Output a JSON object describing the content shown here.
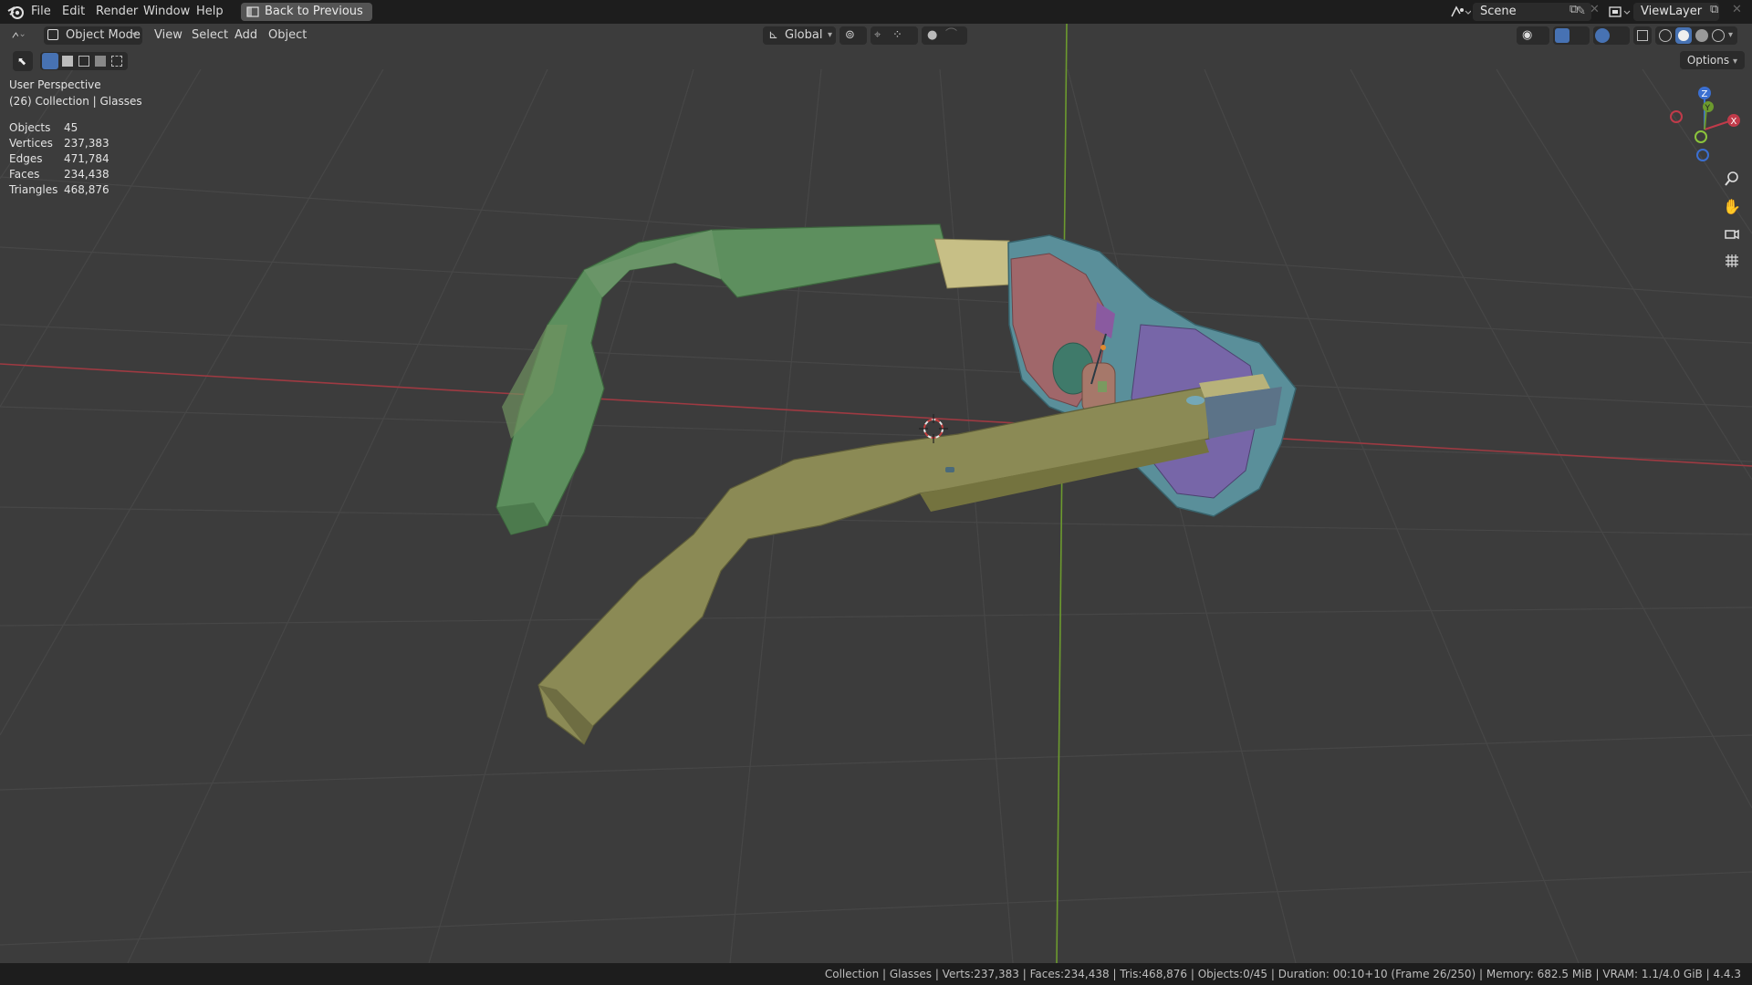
{
  "menu": {
    "items": [
      "File",
      "Edit",
      "Render",
      "Window",
      "Help"
    ],
    "back_button": "Back to Previous"
  },
  "scene": {
    "label": "Scene"
  },
  "view_layer": {
    "label": "ViewLayer"
  },
  "viewport_header": {
    "mode": "Object Mode",
    "menus": [
      "View",
      "Select",
      "Add",
      "Object"
    ],
    "orientation": "Global",
    "options": "Options"
  },
  "overlay": {
    "perspective": "User Perspective",
    "collection": "(26) Collection | Glasses"
  },
  "stats": [
    {
      "label": "Objects",
      "value": "45"
    },
    {
      "label": "Vertices",
      "value": "237,383"
    },
    {
      "label": "Edges",
      "value": "471,784"
    },
    {
      "label": "Faces",
      "value": "234,438"
    },
    {
      "label": "Triangles",
      "value": "468,876"
    }
  ],
  "gizmo": {
    "z": "Z",
    "y": "Y",
    "x": "X"
  },
  "status_bar": {
    "text": "Collection | Glasses | Verts:237,383 | Faces:234,438 | Tris:468,876 | Objects:0/45 | Duration: 00:10+10 (Frame 26/250) | Memory: 682.5 MiB | VRAM: 1.1/4.0 GiB | 4.4.3"
  },
  "colors": {
    "viewport_bg": "#3c3c3c",
    "grid": "#4a4a4a",
    "x_axis": "#b03a44",
    "y_axis": "#6f9a30",
    "frame": "#4e8a96",
    "temple_left": "#5a8f5a",
    "temple_right": "#8a8a55",
    "lens_left": "#9a5c62",
    "lens_right": "#6e5e9c"
  },
  "icons": [
    "blender-logo-icon",
    "back-icon",
    "scene-icon",
    "view-layer-icon",
    "editor-type-icon",
    "mode-icon",
    "orientation-icon",
    "pivot-icon",
    "snap-icon",
    "proportional-icon",
    "visibility-icon",
    "gizmo-toggle-icon",
    "overlay-icon",
    "xray-icon",
    "shading-icon",
    "zoom-icon",
    "pan-icon",
    "camera-icon",
    "grid-view-icon"
  ]
}
